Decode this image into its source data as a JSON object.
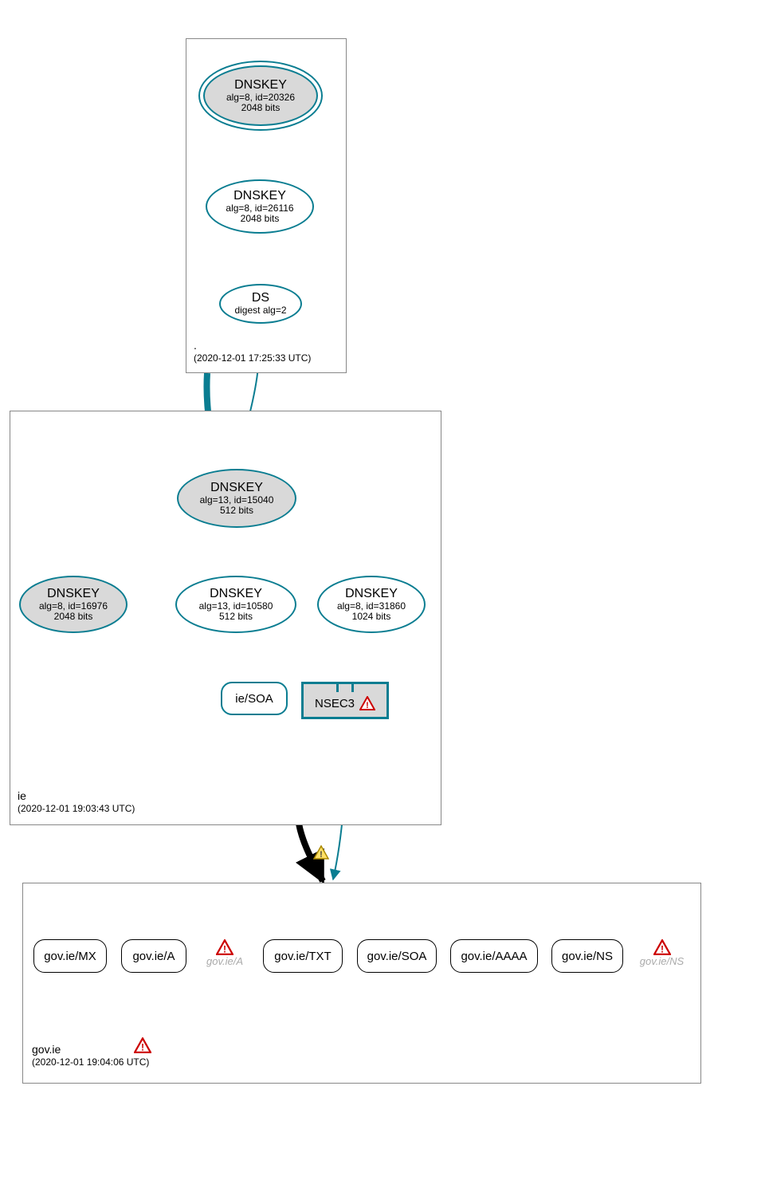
{
  "zones": {
    "root": {
      "name": ".",
      "timestamp": "(2020-12-01 17:25:33 UTC)"
    },
    "ie": {
      "name": "ie",
      "timestamp": "(2020-12-01 19:03:43 UTC)"
    },
    "govie": {
      "name": "gov.ie",
      "timestamp": "(2020-12-01 19:04:06 UTC)"
    }
  },
  "nodes": {
    "root_ksk": {
      "title": "DNSKEY",
      "line1": "alg=8, id=20326",
      "line2": "2048 bits"
    },
    "root_zsk": {
      "title": "DNSKEY",
      "line1": "alg=8, id=26116",
      "line2": "2048 bits"
    },
    "root_ds": {
      "title": "DS",
      "line1": "digest alg=2",
      "line2": ""
    },
    "ie_ksk": {
      "title": "DNSKEY",
      "line1": "alg=13, id=15040",
      "line2": "512 bits"
    },
    "ie_zsk_a": {
      "title": "DNSKEY",
      "line1": "alg=8, id=16976",
      "line2": "2048 bits"
    },
    "ie_zsk_b": {
      "title": "DNSKEY",
      "line1": "alg=13, id=10580",
      "line2": "512 bits"
    },
    "ie_zsk_c": {
      "title": "DNSKEY",
      "line1": "alg=8, id=31860",
      "line2": "1024 bits"
    },
    "ie_soa": {
      "label": "ie/SOA"
    },
    "nsec3": {
      "label": "NSEC3"
    }
  },
  "records": {
    "mx": "gov.ie/MX",
    "a": "gov.ie/A",
    "txt": "gov.ie/TXT",
    "soa": "gov.ie/SOA",
    "aaaa": "gov.ie/AAAA",
    "ns": "gov.ie/NS"
  },
  "ghosts": {
    "a": "gov.ie/A",
    "ns": "gov.ie/NS"
  }
}
